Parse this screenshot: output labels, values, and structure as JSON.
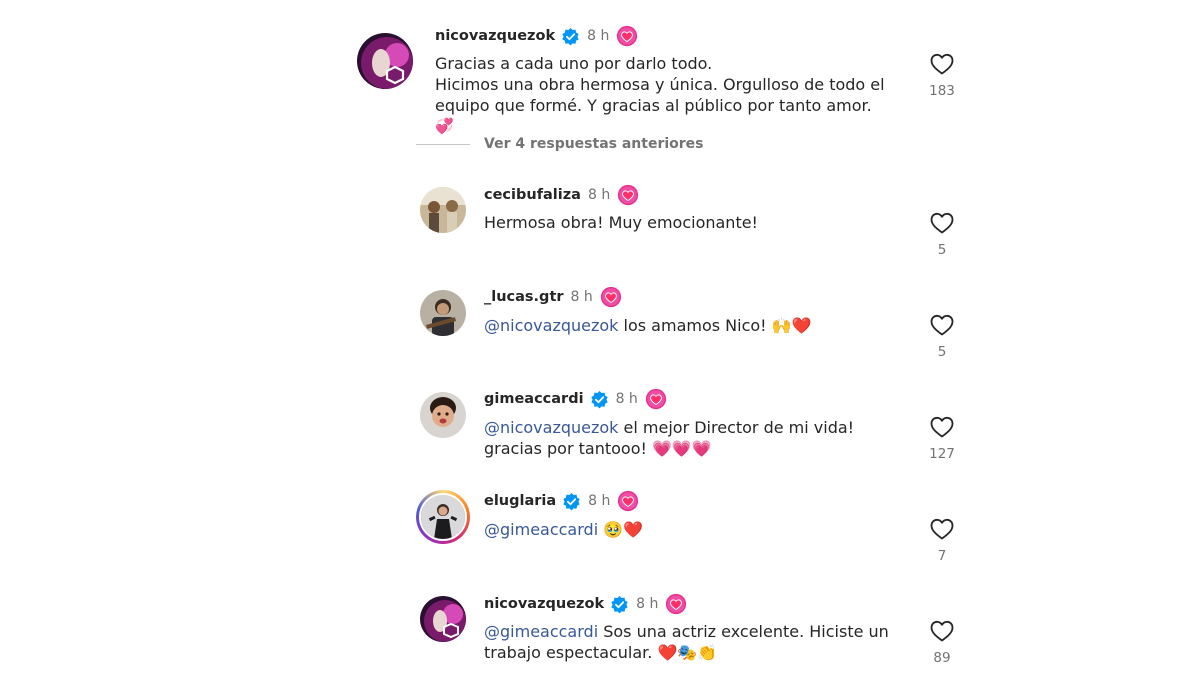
{
  "comments": [
    {
      "username": "nicovazquezok",
      "verified": true,
      "time": "8 h",
      "lines": [
        {
          "mention": "",
          "text": "Gracias a cada uno por darlo todo."
        },
        {
          "mention": "",
          "text": "Hicimos una obra hermosa y única. Orgulloso de todo el"
        },
        {
          "mention": "",
          "text": "equipo que formé. Y gracias al público por tanto amor."
        },
        {
          "mention": "",
          "text": "💞"
        }
      ],
      "likes": "183"
    },
    {
      "username": "cecibufaliza",
      "verified": false,
      "time": "8 h",
      "lines": [
        {
          "mention": "",
          "text": "Hermosa obra! Muy emocionante!"
        }
      ],
      "likes": "5"
    },
    {
      "username": "_lucas.gtr",
      "verified": false,
      "time": "8 h",
      "lines": [
        {
          "mention": "@nicovazquezok",
          "text": " los amamos Nico! 🙌❤️"
        }
      ],
      "likes": "5"
    },
    {
      "username": "gimeaccardi",
      "verified": true,
      "time": "8 h",
      "lines": [
        {
          "mention": "@nicovazquezok",
          "text": " el mejor Director de mi vida!"
        },
        {
          "mention": "",
          "text": "gracias por tantooo! 💗💗💗"
        }
      ],
      "likes": "127"
    },
    {
      "username": "eluglaria",
      "verified": true,
      "time": "8 h",
      "lines": [
        {
          "mention": "@gimeaccardi",
          "text": " 🥹❤️"
        }
      ],
      "likes": "7"
    },
    {
      "username": "nicovazquezok",
      "verified": true,
      "time": "8 h",
      "lines": [
        {
          "mention": "@gimeaccardi",
          "text": " Sos una actriz excelente. Hiciste un"
        },
        {
          "mention": "",
          "text": "trabajo espectacular. ❤️🎭👏"
        }
      ],
      "likes": "89"
    }
  ],
  "replies_toggle": {
    "label": "Ver 4 respuestas anteriores"
  },
  "icons": {
    "verified": "verified-badge-icon",
    "heart": "heart-outline-icon",
    "reaction_badge": "sticker-heart-badge-icon"
  },
  "colors": {
    "verified_blue": "#0095f6",
    "mention_blue": "#385898",
    "meta_gray": "#737373",
    "text": "#262626"
  }
}
